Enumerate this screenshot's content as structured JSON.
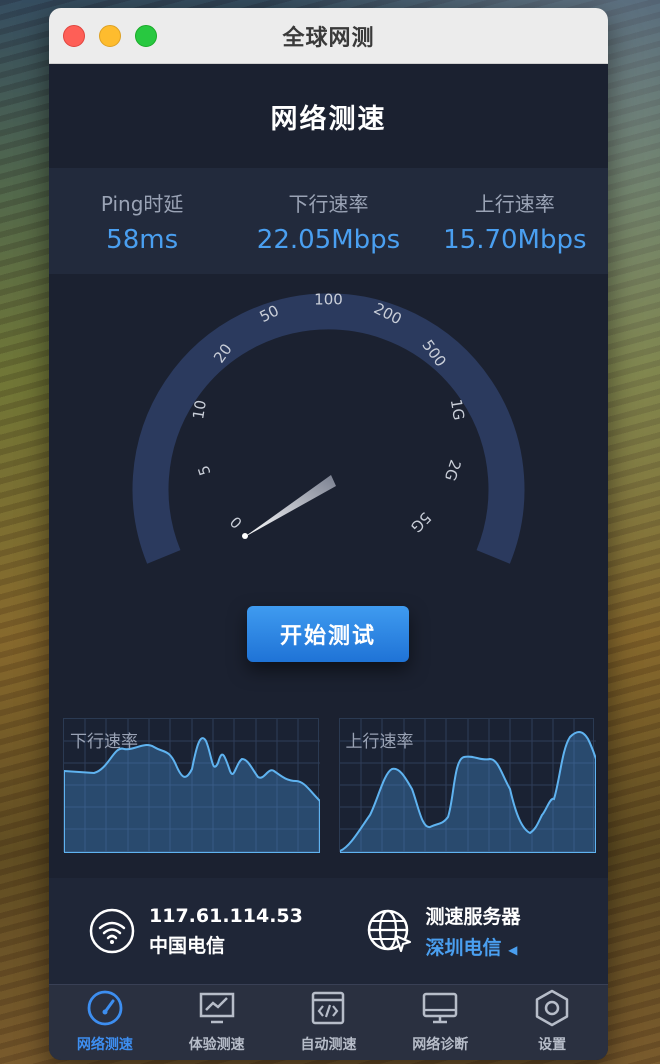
{
  "window": {
    "title": "全球网测"
  },
  "header": {
    "title": "网络测速"
  },
  "stats": [
    {
      "label": "Ping时延",
      "value": "58ms"
    },
    {
      "label": "下行速率",
      "value": "22.05Mbps"
    },
    {
      "label": "上行速率",
      "value": "15.70Mbps"
    }
  ],
  "gauge": {
    "ticks": [
      "0",
      "5",
      "10",
      "20",
      "50",
      "100",
      "200",
      "500",
      "1G",
      "2G",
      "5G"
    ]
  },
  "start_button": {
    "label": "开始测试"
  },
  "graphs": {
    "download_label": "下行速率",
    "upload_label": "上行速率"
  },
  "info": {
    "ip": "117.61.114.53",
    "isp": "中国电信",
    "server_title": "测速服务器",
    "server_name": "深圳电信"
  },
  "tabs": [
    {
      "label": "网络测速",
      "icon": "speedometer-icon",
      "active": true
    },
    {
      "label": "体验测速",
      "icon": "monitor-chart-icon",
      "active": false
    },
    {
      "label": "自动测速",
      "icon": "code-window-icon",
      "active": false
    },
    {
      "label": "网络诊断",
      "icon": "desktop-icon",
      "active": false
    },
    {
      "label": "设置",
      "icon": "gear-icon",
      "active": false
    }
  ],
  "colors": {
    "accent": "#3d8ef0",
    "value_blue": "#4a9ff0",
    "panel": "#1b2130"
  }
}
